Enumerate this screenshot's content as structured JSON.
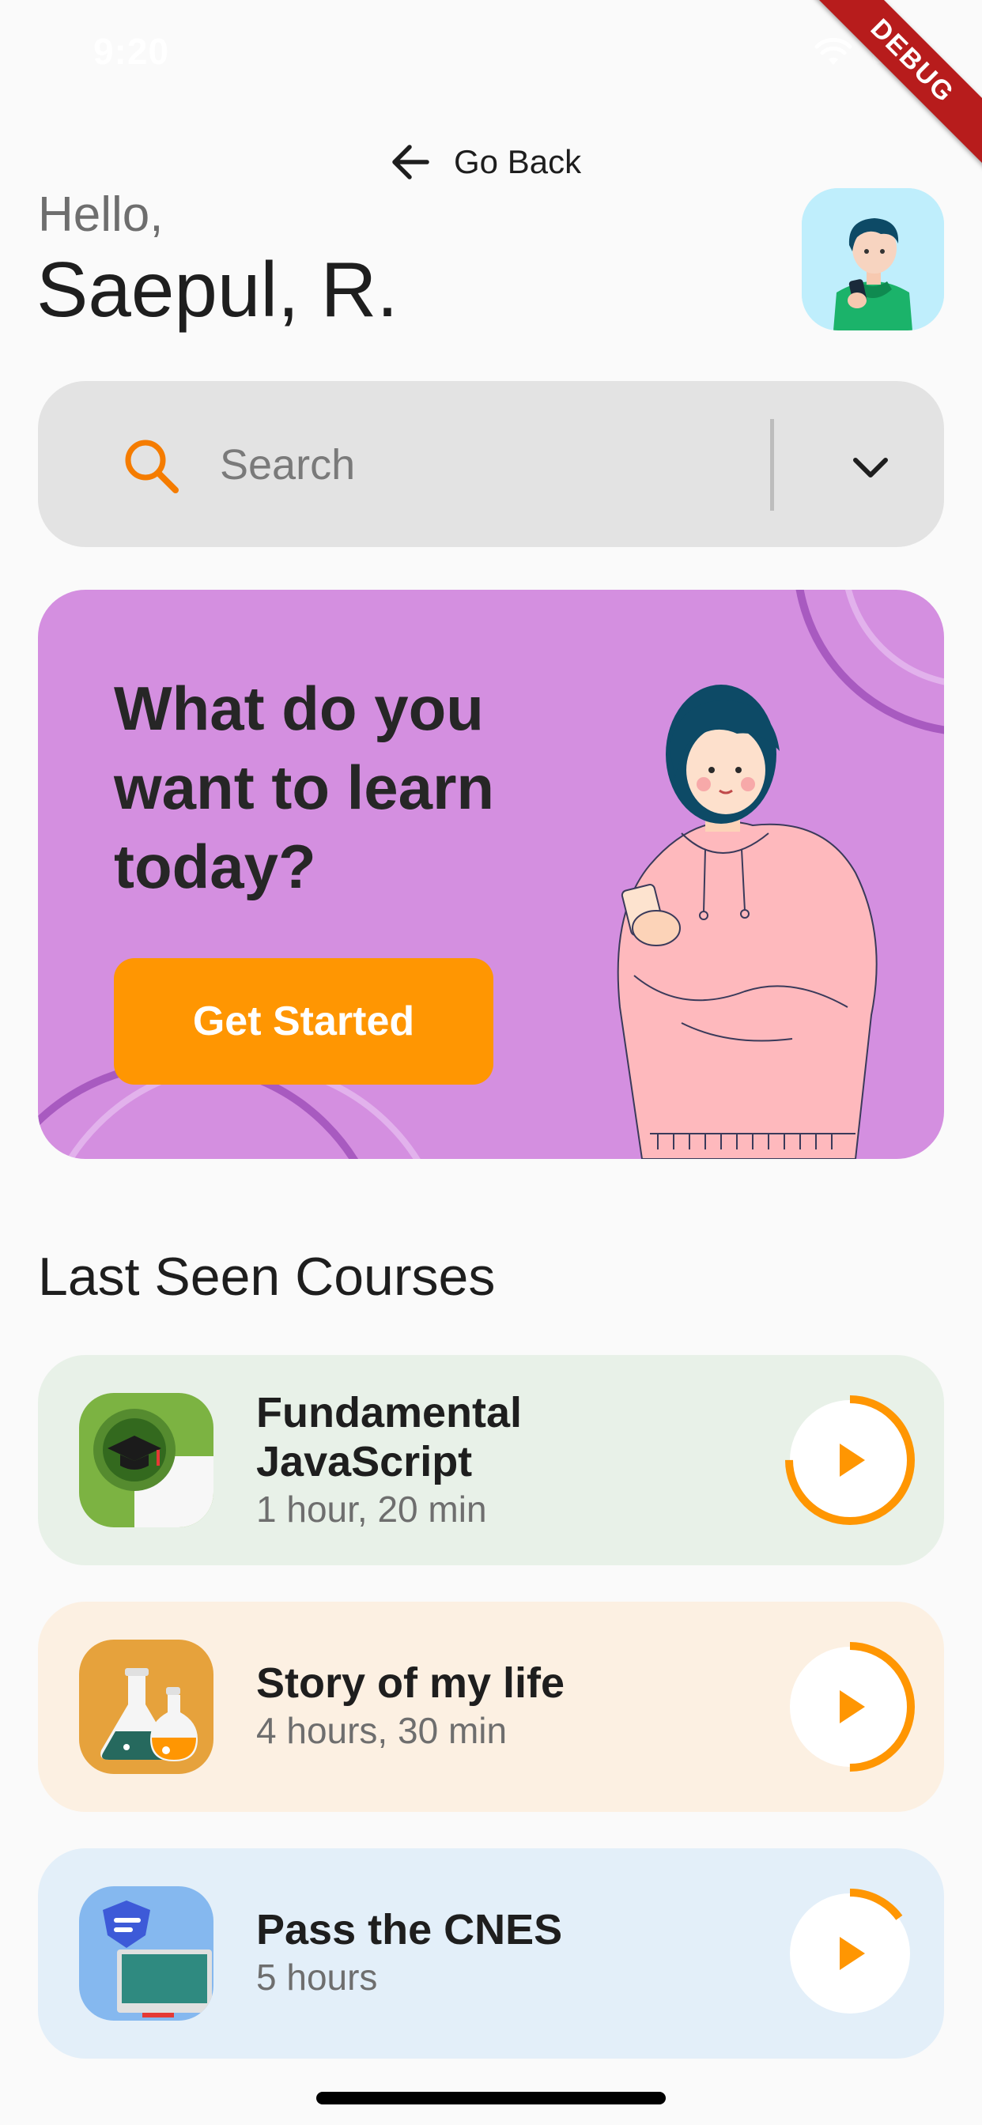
{
  "status_bar": {
    "time": "9:20",
    "debug_label": "DEBUG"
  },
  "nav": {
    "back_label": "Go Back"
  },
  "header": {
    "greeting": "Hello,",
    "user_name": "Saepul, R."
  },
  "search": {
    "placeholder": "Search"
  },
  "banner": {
    "title": "What do you want to learn today?",
    "button_label": "Get Started",
    "background": "#d48fe0",
    "button_color": "#ff9602"
  },
  "courses": {
    "section_title": "Last Seen Courses",
    "items": [
      {
        "title": "Fundamental JavaScript",
        "duration": "1 hour, 20 min",
        "progress": 0.75,
        "card_color": "#e8f1e8"
      },
      {
        "title": "Story of my life",
        "duration": "4 hours, 30 min",
        "progress": 0.5,
        "card_color": "#fcf0e2"
      },
      {
        "title": "Pass the CNES",
        "duration": "5 hours",
        "progress": 0.15,
        "card_color": "#e3eff9"
      }
    ]
  },
  "colors": {
    "accent": "#ff9602",
    "text_primary": "#1e1e1e",
    "text_secondary": "#6e6e6e"
  }
}
